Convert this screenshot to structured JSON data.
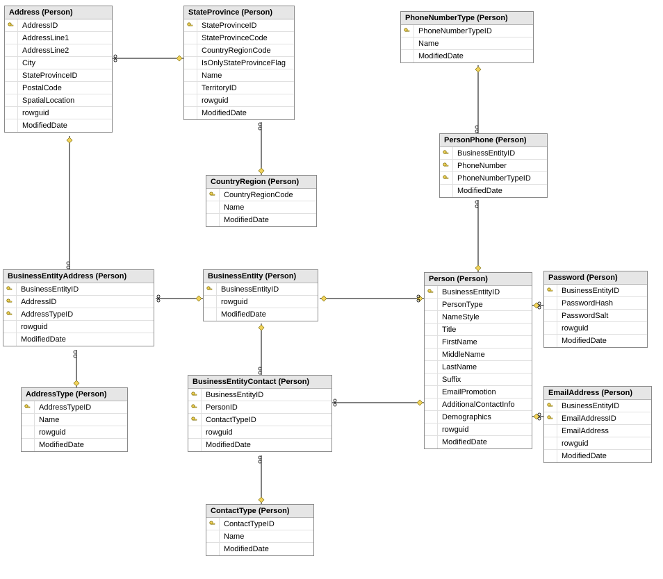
{
  "tables": {
    "address": {
      "title": "Address (Person)",
      "columns": [
        {
          "name": "AddressID",
          "pk": true
        },
        {
          "name": "AddressLine1",
          "pk": false
        },
        {
          "name": "AddressLine2",
          "pk": false
        },
        {
          "name": "City",
          "pk": false
        },
        {
          "name": "StateProvinceID",
          "pk": false
        },
        {
          "name": "PostalCode",
          "pk": false
        },
        {
          "name": "SpatialLocation",
          "pk": false
        },
        {
          "name": "rowguid",
          "pk": false
        },
        {
          "name": "ModifiedDate",
          "pk": false
        }
      ]
    },
    "stateProvince": {
      "title": "StateProvince (Person)",
      "columns": [
        {
          "name": "StateProvinceID",
          "pk": true
        },
        {
          "name": "StateProvinceCode",
          "pk": false
        },
        {
          "name": "CountryRegionCode",
          "pk": false
        },
        {
          "name": "IsOnlyStateProvinceFlag",
          "pk": false
        },
        {
          "name": "Name",
          "pk": false
        },
        {
          "name": "TerritoryID",
          "pk": false
        },
        {
          "name": "rowguid",
          "pk": false
        },
        {
          "name": "ModifiedDate",
          "pk": false
        }
      ]
    },
    "phoneNumberType": {
      "title": "PhoneNumberType (Person)",
      "columns": [
        {
          "name": "PhoneNumberTypeID",
          "pk": true
        },
        {
          "name": "Name",
          "pk": false
        },
        {
          "name": "ModifiedDate",
          "pk": false
        }
      ]
    },
    "personPhone": {
      "title": "PersonPhone (Person)",
      "columns": [
        {
          "name": "BusinessEntityID",
          "pk": true
        },
        {
          "name": "PhoneNumber",
          "pk": true
        },
        {
          "name": "PhoneNumberTypeID",
          "pk": true
        },
        {
          "name": "ModifiedDate",
          "pk": false
        }
      ]
    },
    "countryRegion": {
      "title": "CountryRegion (Person)",
      "columns": [
        {
          "name": "CountryRegionCode",
          "pk": true
        },
        {
          "name": "Name",
          "pk": false
        },
        {
          "name": "ModifiedDate",
          "pk": false
        }
      ]
    },
    "businessEntityAddress": {
      "title": "BusinessEntityAddress (Person)",
      "columns": [
        {
          "name": "BusinessEntityID",
          "pk": true
        },
        {
          "name": "AddressID",
          "pk": true
        },
        {
          "name": "AddressTypeID",
          "pk": true
        },
        {
          "name": "rowguid",
          "pk": false
        },
        {
          "name": "ModifiedDate",
          "pk": false
        }
      ]
    },
    "businessEntity": {
      "title": "BusinessEntity (Person)",
      "columns": [
        {
          "name": "BusinessEntityID",
          "pk": true
        },
        {
          "name": "rowguid",
          "pk": false
        },
        {
          "name": "ModifiedDate",
          "pk": false
        }
      ]
    },
    "person": {
      "title": "Person (Person)",
      "columns": [
        {
          "name": "BusinessEntityID",
          "pk": true
        },
        {
          "name": "PersonType",
          "pk": false
        },
        {
          "name": "NameStyle",
          "pk": false
        },
        {
          "name": "Title",
          "pk": false
        },
        {
          "name": "FirstName",
          "pk": false
        },
        {
          "name": "MiddleName",
          "pk": false
        },
        {
          "name": "LastName",
          "pk": false
        },
        {
          "name": "Suffix",
          "pk": false
        },
        {
          "name": "EmailPromotion",
          "pk": false
        },
        {
          "name": "AdditionalContactInfo",
          "pk": false
        },
        {
          "name": "Demographics",
          "pk": false
        },
        {
          "name": "rowguid",
          "pk": false
        },
        {
          "name": "ModifiedDate",
          "pk": false
        }
      ]
    },
    "password": {
      "title": "Password (Person)",
      "columns": [
        {
          "name": "BusinessEntityID",
          "pk": true
        },
        {
          "name": "PasswordHash",
          "pk": false
        },
        {
          "name": "PasswordSalt",
          "pk": false
        },
        {
          "name": "rowguid",
          "pk": false
        },
        {
          "name": "ModifiedDate",
          "pk": false
        }
      ]
    },
    "addressType": {
      "title": "AddressType (Person)",
      "columns": [
        {
          "name": "AddressTypeID",
          "pk": true
        },
        {
          "name": "Name",
          "pk": false
        },
        {
          "name": "rowguid",
          "pk": false
        },
        {
          "name": "ModifiedDate",
          "pk": false
        }
      ]
    },
    "businessEntityContact": {
      "title": "BusinessEntityContact (Person)",
      "columns": [
        {
          "name": "BusinessEntityID",
          "pk": true
        },
        {
          "name": "PersonID",
          "pk": true
        },
        {
          "name": "ContactTypeID",
          "pk": true
        },
        {
          "name": "rowguid",
          "pk": false
        },
        {
          "name": "ModifiedDate",
          "pk": false
        }
      ]
    },
    "emailAddress": {
      "title": "EmailAddress (Person)",
      "columns": [
        {
          "name": "BusinessEntityID",
          "pk": true
        },
        {
          "name": "EmailAddressID",
          "pk": true
        },
        {
          "name": "EmailAddress",
          "pk": false
        },
        {
          "name": "rowguid",
          "pk": false
        },
        {
          "name": "ModifiedDate",
          "pk": false
        }
      ]
    },
    "contactType": {
      "title": "ContactType (Person)",
      "columns": [
        {
          "name": "ContactTypeID",
          "pk": true
        },
        {
          "name": "Name",
          "pk": false
        },
        {
          "name": "ModifiedDate",
          "pk": false
        }
      ]
    }
  },
  "relationships": [
    {
      "from": "address",
      "to": "stateProvince",
      "desc": "Address.StateProvinceID -> StateProvince.StateProvinceID"
    },
    {
      "from": "stateProvince",
      "to": "countryRegion",
      "desc": "StateProvince.CountryRegionCode -> CountryRegion.CountryRegionCode"
    },
    {
      "from": "businessEntityAddress",
      "to": "address",
      "desc": "BusinessEntityAddress.AddressID -> Address.AddressID"
    },
    {
      "from": "businessEntityAddress",
      "to": "businessEntity",
      "desc": "BusinessEntityAddress.BusinessEntityID -> BusinessEntity.BusinessEntityID"
    },
    {
      "from": "businessEntityAddress",
      "to": "addressType",
      "desc": "BusinessEntityAddress.AddressTypeID -> AddressType.AddressTypeID"
    },
    {
      "from": "businessEntityContact",
      "to": "businessEntity",
      "desc": "BusinessEntityContact.BusinessEntityID -> BusinessEntity.BusinessEntityID"
    },
    {
      "from": "businessEntityContact",
      "to": "person",
      "desc": "BusinessEntityContact.PersonID -> Person.BusinessEntityID"
    },
    {
      "from": "businessEntityContact",
      "to": "contactType",
      "desc": "BusinessEntityContact.ContactTypeID -> ContactType.ContactTypeID"
    },
    {
      "from": "person",
      "to": "businessEntity",
      "desc": "Person.BusinessEntityID -> BusinessEntity.BusinessEntityID"
    },
    {
      "from": "personPhone",
      "to": "phoneNumberType",
      "desc": "PersonPhone.PhoneNumberTypeID -> PhoneNumberType.PhoneNumberTypeID"
    },
    {
      "from": "personPhone",
      "to": "person",
      "desc": "PersonPhone.BusinessEntityID -> Person.BusinessEntityID"
    },
    {
      "from": "password",
      "to": "person",
      "desc": "Password.BusinessEntityID -> Person.BusinessEntityID"
    },
    {
      "from": "emailAddress",
      "to": "person",
      "desc": "EmailAddress.BusinessEntityID -> Person.BusinessEntityID"
    }
  ]
}
